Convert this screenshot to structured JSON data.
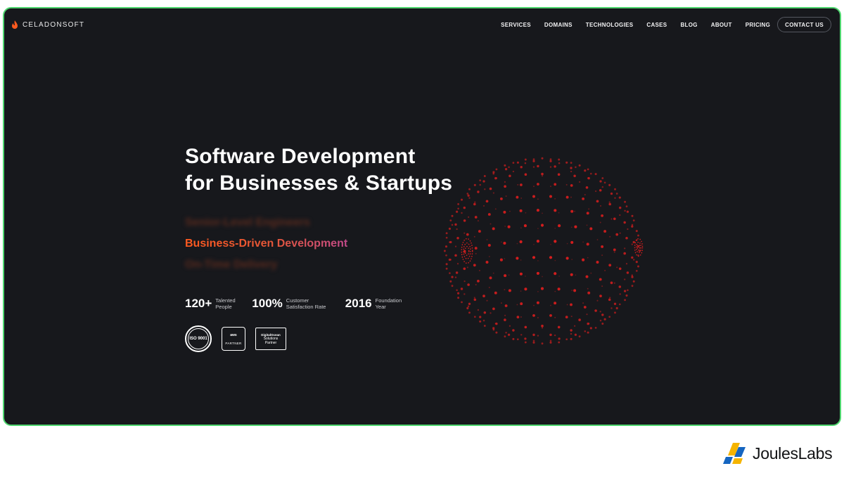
{
  "nav": {
    "logo_text": "CELADONSOFT",
    "menu": [
      "SERVICES",
      "DOMAINS",
      "TECHNOLOGIES",
      "CASES",
      "BLOG",
      "ABOUT",
      "PRICING"
    ],
    "contact_label": "CONTACT US"
  },
  "hero": {
    "title_line1": "Software Development",
    "title_line2": "for Businesses & Startups",
    "rotating": [
      "Senior-Level Engineers",
      "Business-Driven Development",
      "On-Time Delivery"
    ]
  },
  "stats": [
    {
      "value": "120+",
      "label": "Talented People"
    },
    {
      "value": "100%",
      "label": "Customer Satisfaction Rate"
    },
    {
      "value": "2016",
      "label": "Foundation Year"
    }
  ],
  "badges": {
    "iso_text": "ISO 9001",
    "aws_top": "aws",
    "aws_bottom": "PARTNER",
    "do_top": "DigitalOcean",
    "do_mid": "Solutions",
    "do_bot": "Partner"
  },
  "brand": {
    "text": "JoulesLabs"
  },
  "colors": {
    "background": "#17181c",
    "frame_border": "#4fd66f",
    "accent": "#ff5a1f",
    "sphere_dots": "#d61e1e"
  }
}
